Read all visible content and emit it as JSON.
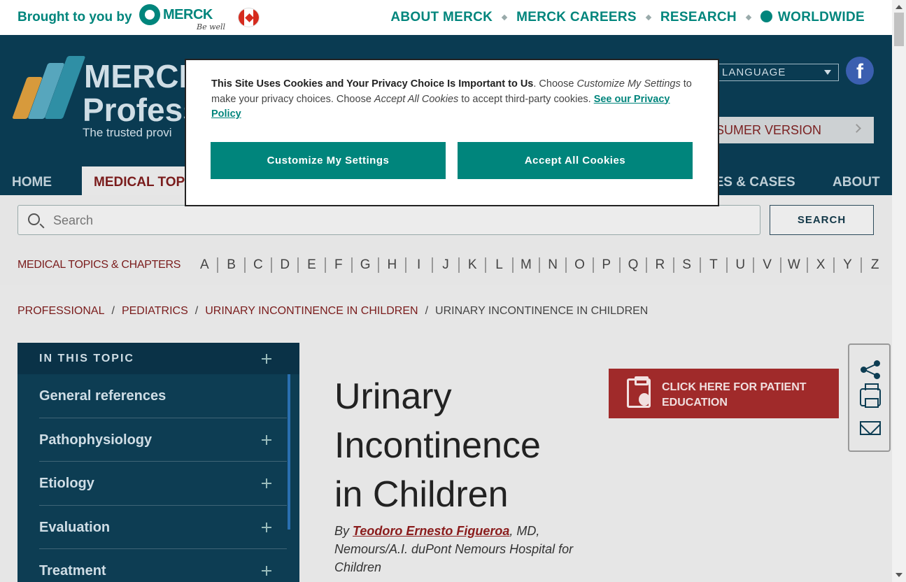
{
  "topbar": {
    "brought_by": "Brought to you by",
    "merck_word": "MERCK",
    "be_well": "Be well",
    "links": [
      "ABOUT MERCK",
      "MERCK CAREERS",
      "RESEARCH",
      "WORLDWIDE"
    ]
  },
  "header": {
    "logo_line1": "MERCK",
    "logo_line2": "Profess",
    "tagline": "The trusted provi",
    "language": "LANGUAGE",
    "consumer": "NSUMER VERSION",
    "nav": {
      "home": "HOME",
      "medical_topics": "MEDICAL TOPI",
      "quizzes": "ZES & CASES",
      "about": "ABOUT"
    }
  },
  "search": {
    "placeholder": "Search",
    "button": "SEARCH"
  },
  "az": {
    "label": "MEDICAL TOPICS & CHAPTERS",
    "letters": [
      "A",
      "B",
      "C",
      "D",
      "E",
      "F",
      "G",
      "H",
      "I",
      "J",
      "K",
      "L",
      "M",
      "N",
      "O",
      "P",
      "Q",
      "R",
      "S",
      "T",
      "U",
      "V",
      "W",
      "X",
      "Y",
      "Z"
    ]
  },
  "breadcrumb": {
    "items": [
      "PROFESSIONAL",
      "PEDIATRICS",
      "URINARY INCONTINENCE IN CHILDREN"
    ],
    "current": "URINARY INCONTINENCE IN CHILDREN",
    "sep": "/"
  },
  "sidebar": {
    "heading": "IN THIS TOPIC",
    "items": [
      {
        "label": "General references",
        "expandable": false
      },
      {
        "label": "Pathophysiology",
        "expandable": true
      },
      {
        "label": "Etiology",
        "expandable": true
      },
      {
        "label": "Evaluation",
        "expandable": true
      },
      {
        "label": "Treatment",
        "expandable": true
      }
    ]
  },
  "article": {
    "title": "Urinary Incontinence in Children",
    "by": "By",
    "author": "Teodoro Ernesto Figueroa",
    "affiliation": ", MD, Nemours/A.I. duPont Nemours Hospital for Children",
    "patient_button": "CLICK HERE FOR PATIENT EDUCATION"
  },
  "cookie": {
    "bold": "This Site Uses Cookies and Your Privacy Choice Is Important to Us",
    "t1": ". Choose ",
    "i1": "Customize My Settings",
    "t2": " to make your privacy choices. Choose ",
    "i2": "Accept All Cookies",
    "t3": " to accept third-party cookies. ",
    "link": "See our Privacy Policy",
    "customize": "Customize My Settings",
    "accept": "Accept All Cookies"
  },
  "colors": {
    "teal": "#00857c",
    "navy": "#0a3b52",
    "maroon": "#7a1c1c"
  }
}
